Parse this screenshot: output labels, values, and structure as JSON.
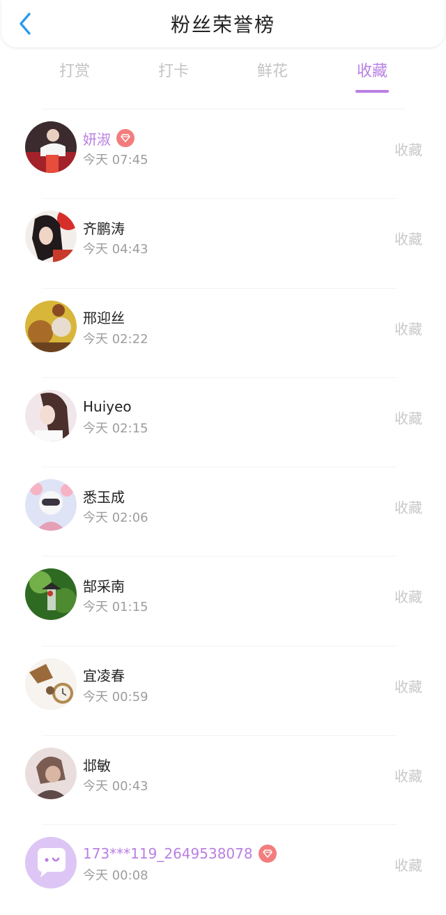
{
  "header": {
    "title": "粉丝荣誉榜",
    "back_icon": "chevron-left-icon"
  },
  "tabs": [
    {
      "label": "打赏",
      "active": false
    },
    {
      "label": "打卡",
      "active": false
    },
    {
      "label": "鲜花",
      "active": false
    },
    {
      "label": "收藏",
      "active": true
    }
  ],
  "colors": {
    "accent": "#b97fe3",
    "back": "#2a9bea",
    "vip_badge": "#f37d7d",
    "muted": "#9d9d9d"
  },
  "fans": [
    {
      "name": "妍淑",
      "vip": true,
      "time": "今天 07:45",
      "action": "收藏",
      "avatar": "photo-avatar"
    },
    {
      "name": "齐鹏涛",
      "vip": false,
      "time": "今天 04:43",
      "action": "收藏",
      "avatar": "photo-avatar"
    },
    {
      "name": "邢迎丝",
      "vip": false,
      "time": "今天 02:22",
      "action": "收藏",
      "avatar": "photo-avatar"
    },
    {
      "name": "Huiyeo",
      "vip": false,
      "time": "今天 02:15",
      "action": "收藏",
      "avatar": "photo-avatar"
    },
    {
      "name": "悉玉成",
      "vip": false,
      "time": "今天 02:06",
      "action": "收藏",
      "avatar": "photo-avatar"
    },
    {
      "name": "郜采南",
      "vip": false,
      "time": "今天 01:15",
      "action": "收藏",
      "avatar": "photo-avatar"
    },
    {
      "name": "宜凌春",
      "vip": false,
      "time": "今天 00:59",
      "action": "收藏",
      "avatar": "photo-avatar"
    },
    {
      "name": "邶敏",
      "vip": false,
      "time": "今天 00:43",
      "action": "收藏",
      "avatar": "photo-avatar"
    },
    {
      "name": "173***119_2649538078",
      "vip": true,
      "time": "今天 00:08",
      "action": "收藏",
      "avatar": "chat-bubble-icon"
    }
  ]
}
